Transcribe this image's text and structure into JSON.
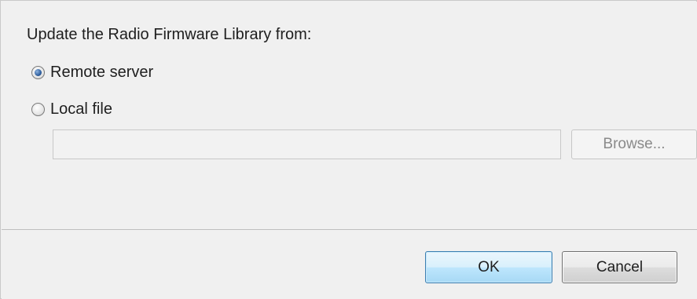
{
  "dialog": {
    "prompt": "Update the Radio Firmware Library from:",
    "options": [
      {
        "label": "Remote server",
        "checked": true
      },
      {
        "label": "Local file",
        "checked": false
      }
    ],
    "file_path": {
      "value": "",
      "placeholder": ""
    },
    "browse_label": "Browse...",
    "ok_label": "OK",
    "cancel_label": "Cancel"
  },
  "colors": {
    "dialog_background": "#f0f0f0",
    "default_button_border": "#3c7fb1",
    "disabled_text": "#8a8a8a"
  },
  "icons": {
    "radio_selected": "radio-selected-icon",
    "radio_unselected": "radio-unselected-icon"
  }
}
